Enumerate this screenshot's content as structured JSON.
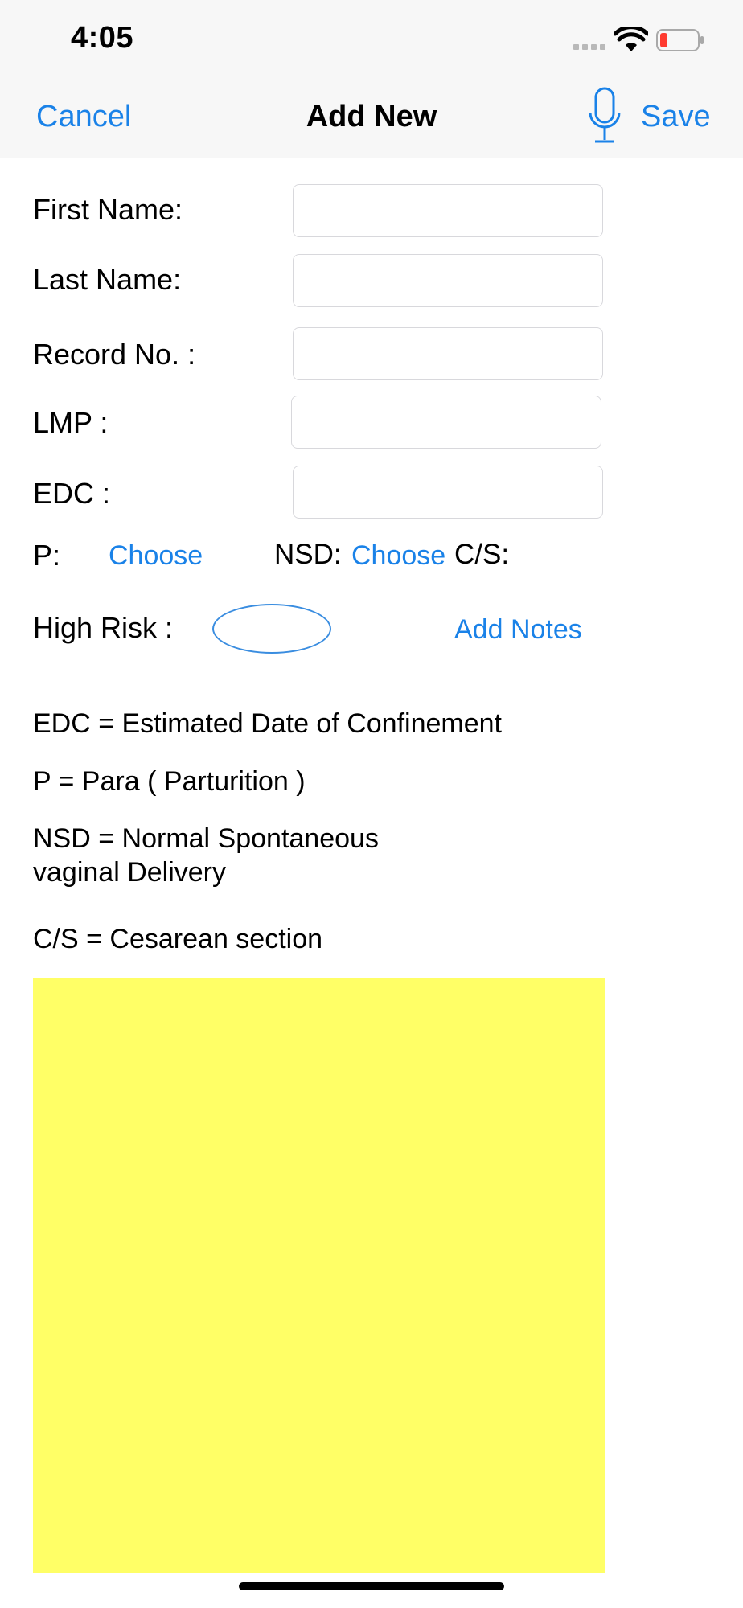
{
  "status_bar": {
    "time": "4:05"
  },
  "nav": {
    "cancel": "Cancel",
    "title": "Add New",
    "save": "Save"
  },
  "form": {
    "first_name_label": "First Name:",
    "last_name_label": "Last Name:",
    "record_no_label": "Record No. :",
    "lmp_label": "LMP :",
    "edc_label": "EDC :",
    "p_label": "P:",
    "p_choose": "Choose",
    "nsd_label": "NSD:",
    "nsd_choose": "Choose",
    "cs_label": "C/S:",
    "high_risk_label": "High Risk :",
    "add_notes": "Add Notes",
    "first_name": "",
    "last_name": "",
    "record_no": "",
    "lmp": "",
    "edc": ""
  },
  "definitions": {
    "edc": "EDC = Estimated Date of Confinement",
    "p": "P = Para ( Parturition )",
    "nsd_line1": "NSD = Normal Spontaneous",
    "nsd_line2": "vaginal Delivery",
    "cs": "C/S = Cesarean section"
  },
  "colors": {
    "accent": "#1a82e8",
    "notes_background": "#ffff66",
    "battery_low": "#ff3b30"
  },
  "icons": [
    "signal-icon",
    "wifi-icon",
    "battery-icon",
    "microphone-icon"
  ]
}
